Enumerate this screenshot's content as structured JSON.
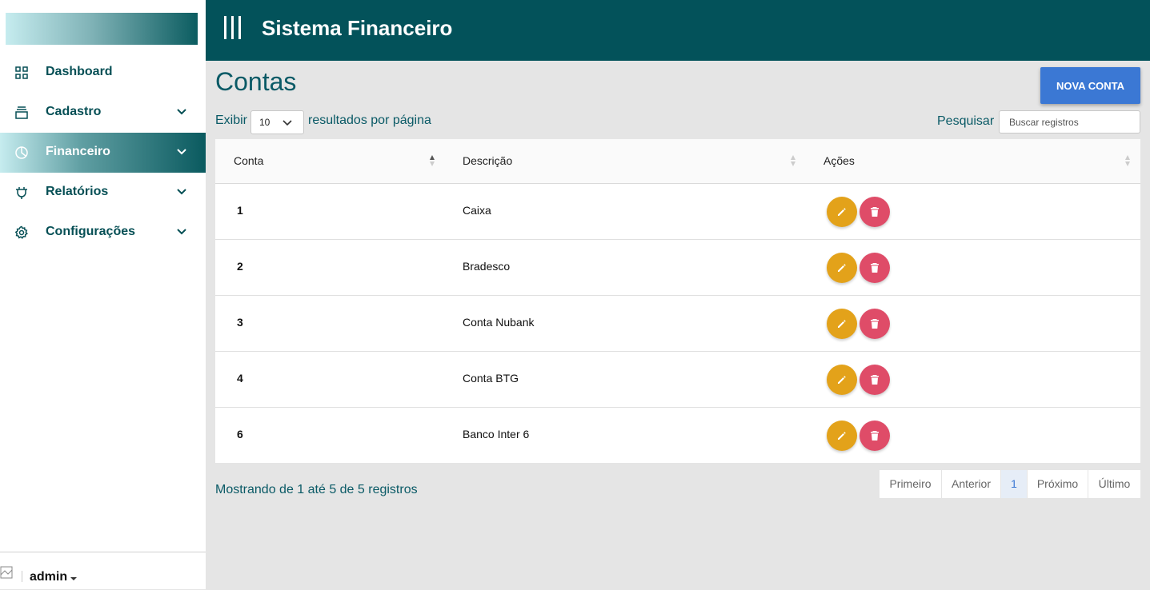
{
  "app": {
    "title": "Sistema Financeiro"
  },
  "sidebar": {
    "items": [
      {
        "label": "Dashboard",
        "icon": "grid-icon",
        "active": false,
        "has_submenu": false
      },
      {
        "label": "Cadastro",
        "icon": "layers-icon",
        "active": false,
        "has_submenu": true
      },
      {
        "label": "Financeiro",
        "icon": "pie-chart-icon",
        "active": true,
        "has_submenu": true
      },
      {
        "label": "Relatórios",
        "icon": "plug-icon",
        "active": false,
        "has_submenu": true
      },
      {
        "label": "Configurações",
        "icon": "gear-icon",
        "active": false,
        "has_submenu": true
      }
    ],
    "user": {
      "name": "admin"
    }
  },
  "main": {
    "title": "Contas",
    "new_button_label": "NOVA CONTA",
    "show_label": "Exibir",
    "per_page_value": "10",
    "results_label": "resultados por página",
    "search_label": "Pesquisar",
    "search_placeholder": "Buscar registros",
    "table": {
      "headers": [
        "Conta",
        "Descrição",
        "Ações"
      ],
      "rows": [
        {
          "id": "1",
          "description": "Caixa"
        },
        {
          "id": "2",
          "description": "Bradesco"
        },
        {
          "id": "3",
          "description": "Conta Nubank"
        },
        {
          "id": "4",
          "description": "Conta BTG"
        },
        {
          "id": "6",
          "description": "Banco Inter 6"
        }
      ]
    },
    "footer_info": "Mostrando de 1 até 5 de 5 registros",
    "pagination": {
      "first": "Primeiro",
      "previous": "Anterior",
      "current": "1",
      "next": "Próximo",
      "last": "Último"
    }
  },
  "colors": {
    "header": "#03525a",
    "primary_button": "#3b78d4",
    "edit": "#e3a21a",
    "delete": "#df4c68",
    "text_teal": "#0a5a66"
  }
}
